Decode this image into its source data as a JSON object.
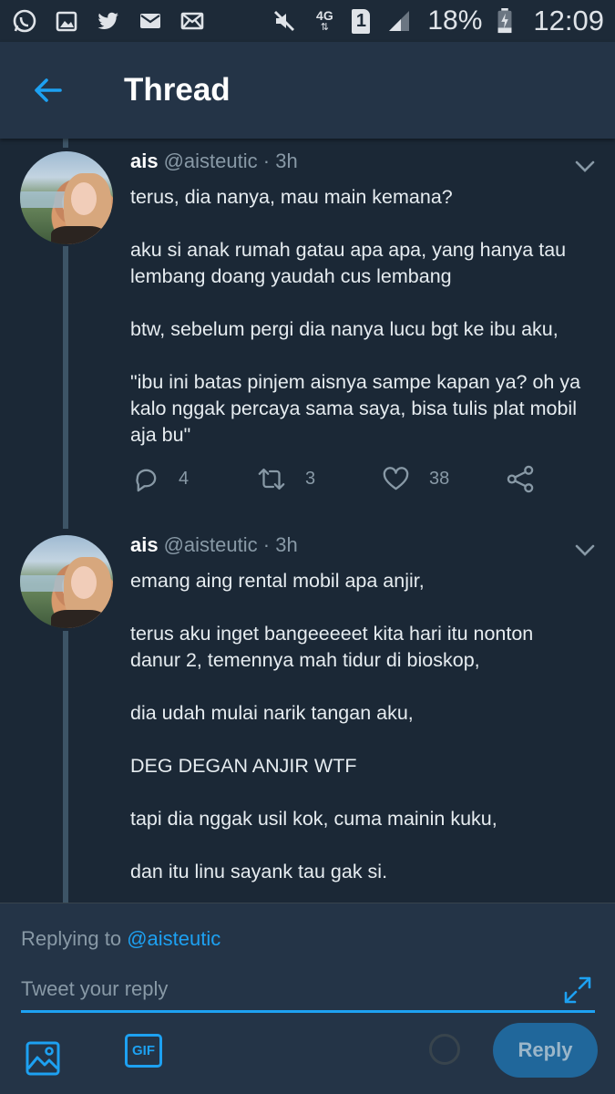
{
  "status_bar": {
    "network": "4G",
    "sim": "1",
    "battery": "18%",
    "time": "12:09",
    "left_icons": [
      "whatsapp-icon",
      "gallery-icon",
      "twitter-icon",
      "mail-icon",
      "email-icon"
    ]
  },
  "header": {
    "title": "Thread"
  },
  "tweets": [
    {
      "name": "ais",
      "handle": "@aisteutic",
      "time": "· 3h",
      "paragraphs": [
        "terus, dia nanya, mau main kemana?",
        "aku si anak rumah gatau apa apa, yang hanya tau\nlembang doang yaudah cus lembang",
        "btw, sebelum pergi dia nanya lucu bgt ke ibu aku,",
        "\"ibu ini batas pinjem aisnya sampe kapan ya? oh ya\nkalo nggak percaya sama saya, bisa tulis plat mobil\naja bu\""
      ],
      "replies": "4",
      "retweets": "3",
      "likes": "38"
    },
    {
      "name": "ais",
      "handle": "@aisteutic",
      "time": "· 3h",
      "paragraphs": [
        "emang aing rental mobil apa anjir,",
        "terus aku inget bangeeeeet kita hari itu nonton\ndanur 2, temennya mah tidur di bioskop,",
        "dia udah mulai narik tangan aku,",
        "DEG DEGAN ANJIR WTF",
        "tapi dia nggak usil kok, cuma mainin kuku,",
        "dan itu linu sayank tau gak si."
      ]
    }
  ],
  "composer": {
    "replying_label": "Replying to",
    "replying_handle": "@aisteutic",
    "placeholder": "Tweet your reply",
    "gif_label": "GIF",
    "reply_button": "Reply"
  },
  "colors": {
    "background": "#1b2836",
    "header": "#243447",
    "accent": "#1da1f2",
    "muted": "#8899a6"
  }
}
